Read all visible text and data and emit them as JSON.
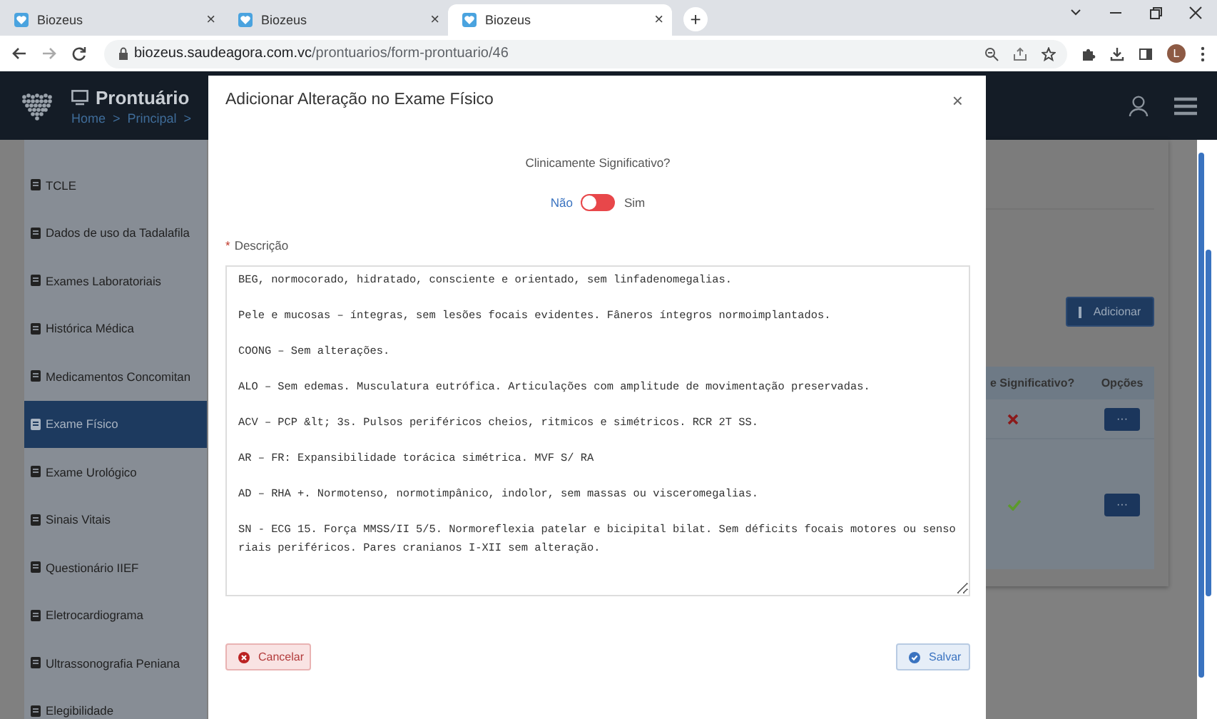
{
  "browser": {
    "tabs": [
      {
        "title": "Biozeus",
        "close": "×",
        "selected": false
      },
      {
        "title": "Biozeus",
        "close": "×",
        "selected": false
      },
      {
        "title": "Biozeus",
        "close": "×",
        "selected": true
      }
    ],
    "new_tab": "+",
    "url_host": "biozeus.saudeagora.com.vc",
    "url_path": "/prontuarios/form-prontuario/46",
    "profile_initial": "L"
  },
  "header": {
    "title": "Prontuário",
    "breadcrumb": [
      "Home",
      "Principal"
    ],
    "separator": ">"
  },
  "sidebar": {
    "items": [
      {
        "label": "TCLE",
        "selected": false
      },
      {
        "label": "Dados de uso da Tadalafila",
        "selected": false
      },
      {
        "label": "Exames Laboratoriais",
        "selected": false
      },
      {
        "label": "Histórica Médica",
        "selected": false
      },
      {
        "label": "Medicamentos Concomitan",
        "selected": false
      },
      {
        "label": "Exame Físico",
        "selected": true
      },
      {
        "label": "Exame Urológico",
        "selected": false
      },
      {
        "label": "Sinais Vitais",
        "selected": false
      },
      {
        "label": "Questionário IIEF",
        "selected": false
      },
      {
        "label": "Eletrocardiograma",
        "selected": false
      },
      {
        "label": "Ultrassonografia Peniana",
        "selected": false
      },
      {
        "label": "Elegibilidade",
        "selected": false
      }
    ]
  },
  "main": {
    "add_button": "Adicionar",
    "table": {
      "columns": [
        "e Significativo?",
        "Opções"
      ],
      "rows": [
        {
          "significant": false,
          "options": "···"
        },
        {
          "significant": true,
          "options": "···"
        }
      ]
    }
  },
  "modal": {
    "title": "Adicionar Alteração no Exame Físico",
    "close": "×",
    "question": "Clinicamente Significativo?",
    "toggle": {
      "off_label": "Não",
      "on_label": "Sim",
      "on": false
    },
    "required_mark": "*",
    "description_label": "Descrição",
    "description": "BEG, normocorado, hidratado, consciente e orientado, sem linfadenomegalias.\n\nPele e mucosas – íntegras, sem lesões focais evidentes. Fâneros íntegros normoimplantados.\n\nCOONG – Sem alterações.\n\nALO – Sem edemas. Musculatura eutrófica. Articulações com amplitude de movimentação preservadas.\n\nACV – PCP &lt; 3s. Pulsos periféricos cheios, ritmicos e simétricos. RCR 2T SS.\n\nAR – FR: Expansibilidade torácica simétrica. MVF S/ RA\n\nAD – RHA +. Normotenso, normotimpânico, indolor, sem massas ou visceromegalias.\n\nSN - ECG 15. Força MMSS/II 5/5. Normoreflexia patelar e bicipital bilat. Sem déficits focais motores ou sensoriais periféricos. Pares cranianos I-XII sem alteração.",
    "cancel": "Cancelar",
    "save": "Salvar"
  }
}
